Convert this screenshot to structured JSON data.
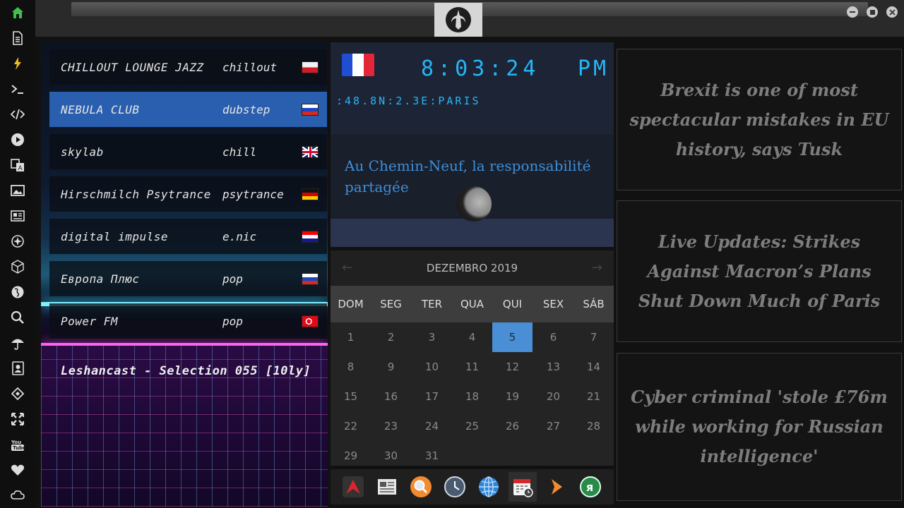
{
  "window": {
    "controls": [
      "minimize",
      "maximize",
      "close"
    ]
  },
  "sidebar": {
    "icons": [
      "home-icon",
      "document-icon",
      "bolt-icon",
      "terminal-icon",
      "code-icon",
      "play-icon",
      "translate-icon",
      "image-icon",
      "news-icon",
      "galaxy-icon",
      "cube-icon",
      "globe-icon",
      "search-icon",
      "umbrella-icon",
      "contacts-icon",
      "diamond-icon",
      "expand-icon",
      "youtube-icon",
      "heart-icon",
      "cloud-icon"
    ]
  },
  "radio": {
    "stations": [
      {
        "name": "CHILLOUT LOUNGE JAZZ",
        "genre": "chillout",
        "flag": "pl"
      },
      {
        "name": "NEBULA CLUB",
        "genre": "dubstep",
        "flag": "ru"
      },
      {
        "name": "skylab",
        "genre": "chill",
        "flag": "gb"
      },
      {
        "name": "Hirschmilch Psytrance",
        "genre": "psytrance",
        "flag": "de"
      },
      {
        "name": "digital impulse",
        "genre": "e.nic",
        "flag": "hr"
      },
      {
        "name": "Европа Плюс",
        "genre": "pop",
        "flag": "ru"
      },
      {
        "name": "Power FM",
        "genre": "pop",
        "flag": "tr"
      }
    ],
    "active_index": 1,
    "now_playing": "Leshancast - Selection 055 [10ly]"
  },
  "clock": {
    "time": "8:03:24",
    "ampm": "PM",
    "location": ":48.8N:2.3E:PARIS",
    "headline": "Au Chemin-Neuf, la responsabilité partagée"
  },
  "calendar": {
    "month_label": "DEZEMBRO 2019",
    "weekdays": [
      "DOM",
      "SEG",
      "TER",
      "QUA",
      "QUI",
      "SEX",
      "SÁB"
    ],
    "first_weekday_index": 0,
    "days_in_month": 31,
    "today": 5
  },
  "dock": {
    "apps": [
      "artix-icon",
      "newspaper-icon",
      "magnifier-icon",
      "clock-icon",
      "web-browser-icon",
      "calendar-icon",
      "arrow-play-icon",
      "yandex-icon"
    ],
    "active_index": 5
  },
  "news": {
    "items": [
      "Brexit is one of most spectacular mistakes in EU history, says Tusk",
      "Live Updates: Strikes Against Macron’s Plans Shut Down Much of Paris",
      "Cyber criminal 'stole £76m while working for Russian intelligence'"
    ]
  },
  "colors": {
    "accent": "#27b6f5",
    "active_station": "#2a5fb0",
    "today": "#4a8fd6",
    "home": "#3cc24a"
  }
}
